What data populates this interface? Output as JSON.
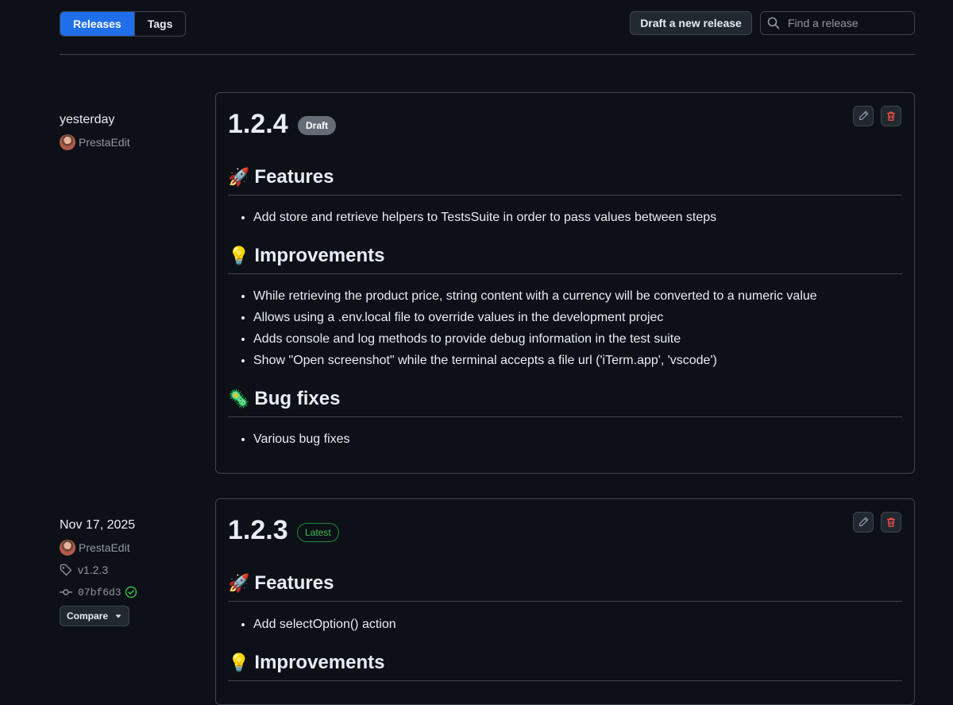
{
  "tabs": {
    "releases": "Releases",
    "tags": "Tags"
  },
  "toolbar": {
    "draft_label": "Draft a new release",
    "search_placeholder": "Find a release"
  },
  "releases": [
    {
      "date": "yesterday",
      "author": "PrestaEdit",
      "version": "1.2.4",
      "badge": "Draft",
      "sections": [
        {
          "emoji": "🚀",
          "title": "Features",
          "items": [
            "Add store and retrieve helpers to TestsSuite in order to pass values between steps"
          ]
        },
        {
          "emoji": "💡",
          "title": "Improvements",
          "items": [
            "While retrieving the product price, string content with a currency will be converted to a numeric value",
            "Allows using a  .env.local  file to override values in the development projec",
            "Adds console and log methods to provide debug information in the test suite",
            "Show \"Open screenshot\" while the terminal accepts a file url ('iTerm.app', 'vscode')"
          ]
        },
        {
          "emoji": "🦠",
          "title": "Bug fixes",
          "items": [
            "Various bug fixes"
          ]
        }
      ]
    },
    {
      "date": "Nov 17, 2025",
      "author": "PrestaEdit",
      "tag": "v1.2.3",
      "commit": "07bf6d3",
      "compare_label": "Compare",
      "version": "1.2.3",
      "badge": "Latest",
      "sections": [
        {
          "emoji": "🚀",
          "title": "Features",
          "items": [
            "Add selectOption() action"
          ]
        },
        {
          "emoji": "💡",
          "title": "Improvements",
          "items": []
        }
      ]
    }
  ],
  "colors": {
    "accent": "#1f6feb",
    "danger": "#f85149",
    "success": "#3fb950",
    "background": "#0d1117",
    "border": "#3d444d"
  }
}
